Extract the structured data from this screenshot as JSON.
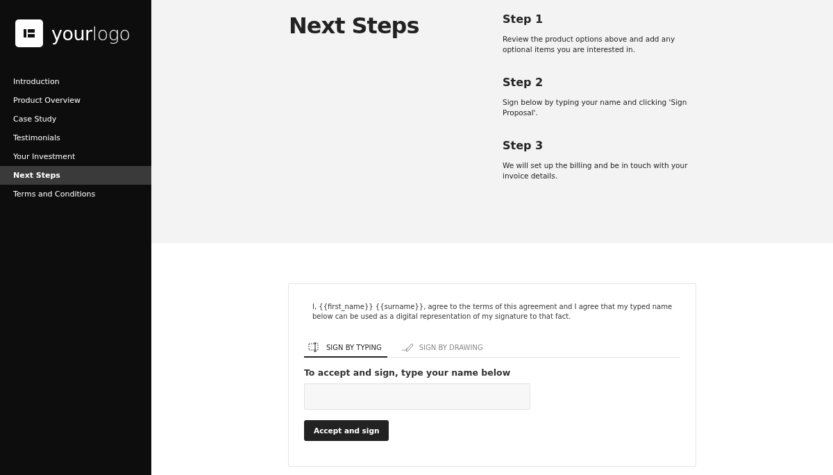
{
  "sidebar": {
    "logo": "**your**logo",
    "items": [
      {
        "label": "Introduction",
        "selected": false
      },
      {
        "label": "Product Overview",
        "selected": false
      },
      {
        "label": "Case Study",
        "selected": false
      },
      {
        "label": "Testimonials",
        "selected": false
      },
      {
        "label": "Your Investment",
        "selected": false
      },
      {
        "label": "Next Steps",
        "selected": true
      },
      {
        "label": "Terms and Conditions",
        "selected": false
      }
    ]
  },
  "next_steps": {
    "title": "Next Steps",
    "steps": [
      {
        "title": "Step 1",
        "text": "Review the product options above and add any optional items you are interested in."
      },
      {
        "title": "Step 2",
        "text": "Sign below by typing your name and clicking 'Sign Proposal'."
      },
      {
        "title": "Step 3",
        "text": "We will set up the billing and be in touch with your invoice details."
      }
    ]
  },
  "signature": {
    "agreement": "I, {{first_name}} {{surname}}, agree to the terms of this agreement and I agree that my typed name below can be used as a digital representation of my signature to that fact.",
    "tabs": [
      {
        "kind": "typing",
        "label": "SIGN BY TYPING",
        "selected": true
      },
      {
        "kind": "drawing",
        "label": "SIGN BY DRAWING",
        "selected": false
      }
    ],
    "prompt": "To accept and sign, type your name below",
    "button": "Accept and sign"
  }
}
